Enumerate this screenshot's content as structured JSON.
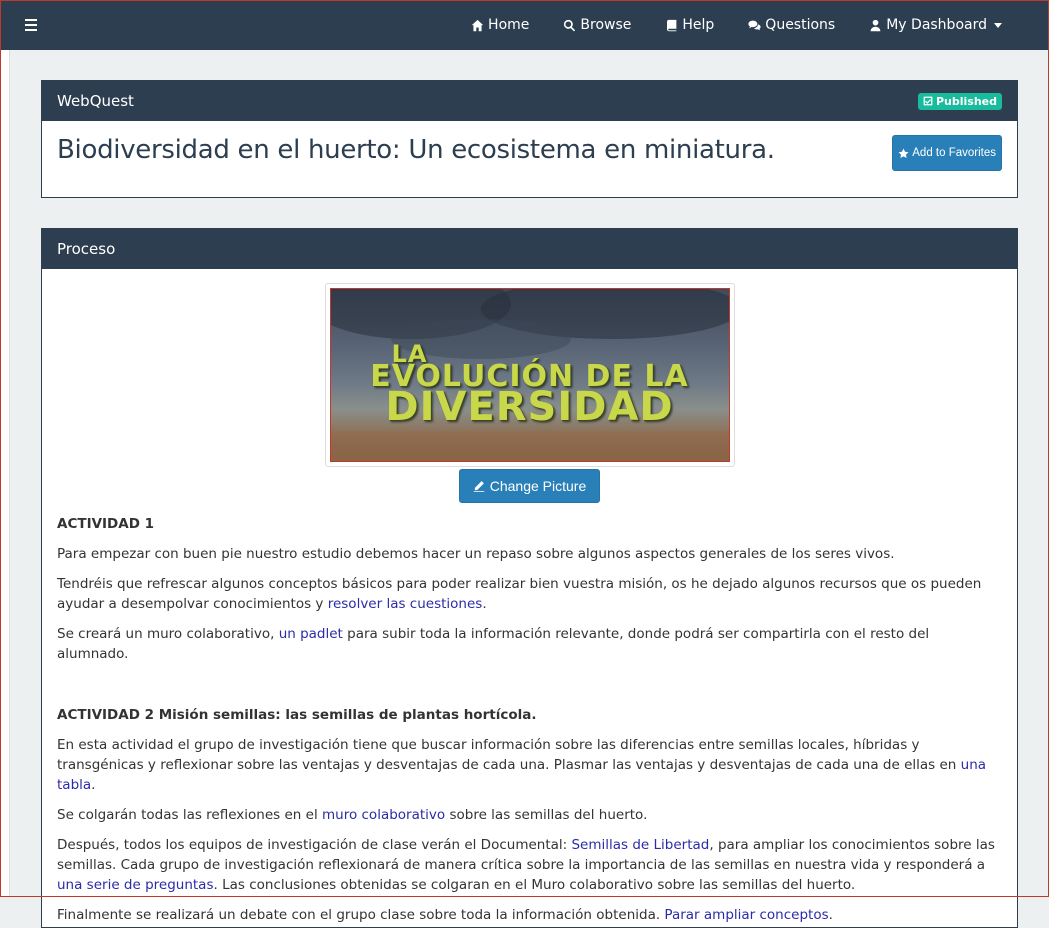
{
  "nav": {
    "items": [
      {
        "label": "Home",
        "icon": "home-icon"
      },
      {
        "label": "Browse",
        "icon": "search-icon"
      },
      {
        "label": "Help",
        "icon": "book-icon"
      },
      {
        "label": "Questions",
        "icon": "comments-icon"
      },
      {
        "label": "My Dashboard",
        "icon": "user-icon"
      }
    ]
  },
  "webquest": {
    "heading": "WebQuest",
    "badge": "Published",
    "title": "Biodiversidad en el huerto: Un ecosistema en miniatura.",
    "favorites_label": "Add to Favorites"
  },
  "proceso": {
    "heading": "Proceso",
    "image_text": [
      "LA",
      "EVOLUCIÓN DE LA",
      "DIVERSIDAD"
    ],
    "change_picture": "Change Picture",
    "act1": {
      "title": "ACTIVIDAD 1",
      "p1": "Para empezar con buen pie nuestro estudio debemos hacer un repaso sobre algunos aspectos generales de los seres vivos.",
      "p2_a": "Tendréis que refrescar algunos conceptos básicos para poder realizar bien vuestra misión, os he dejado algunos recursos que os pueden ayudar a desempolvar conocimientos y ",
      "p2_link": "resolver las cuestiones",
      "p2_b": ".",
      "p3_a": "Se creará un muro colaborativo, ",
      "p3_link": "un padlet",
      "p3_b": " para subir toda la información relevante, donde podrá ser compartirla con el resto del alumnado."
    },
    "act2": {
      "title": "ACTIVIDAD 2 Misión semillas: las semillas de plantas hortícola.",
      "p1_a": "En esta actividad el grupo de investigación tiene que buscar información sobre las diferencias entre semillas locales, híbridas y transgénicas y reflexionar sobre las ventajas y desventajas de cada una. Plasmar las ventajas y desventajas de cada una de ellas en ",
      "p1_link": "una tabla",
      "p1_b": ".",
      "p2_a": "Se colgarán todas las reflexiones en el ",
      "p2_link": "muro colaborativo",
      "p2_b": " sobre las semillas del huerto.",
      "p3_a": "Después, todos los equipos de investigación de clase verán el Documental: ",
      "p3_link1": "Semillas de Libertad",
      "p3_b": ", para ampliar los conocimientos sobre las semillas. Cada grupo de investigación reflexionará de manera crítica sobre la importancia de las semillas en nuestra vida y responderá a ",
      "p3_link2": "una serie de preguntas",
      "p3_c": ". Las conclusiones obtenidas se colgaran en el Muro colaborativo sobre las semillas del huerto.",
      "p4_a": "Finalmente se realizará un debate con el grupo clase sobre toda la información obtenida. ",
      "p4_link": "Parar ampliar conceptos",
      "p4_b": "."
    }
  }
}
